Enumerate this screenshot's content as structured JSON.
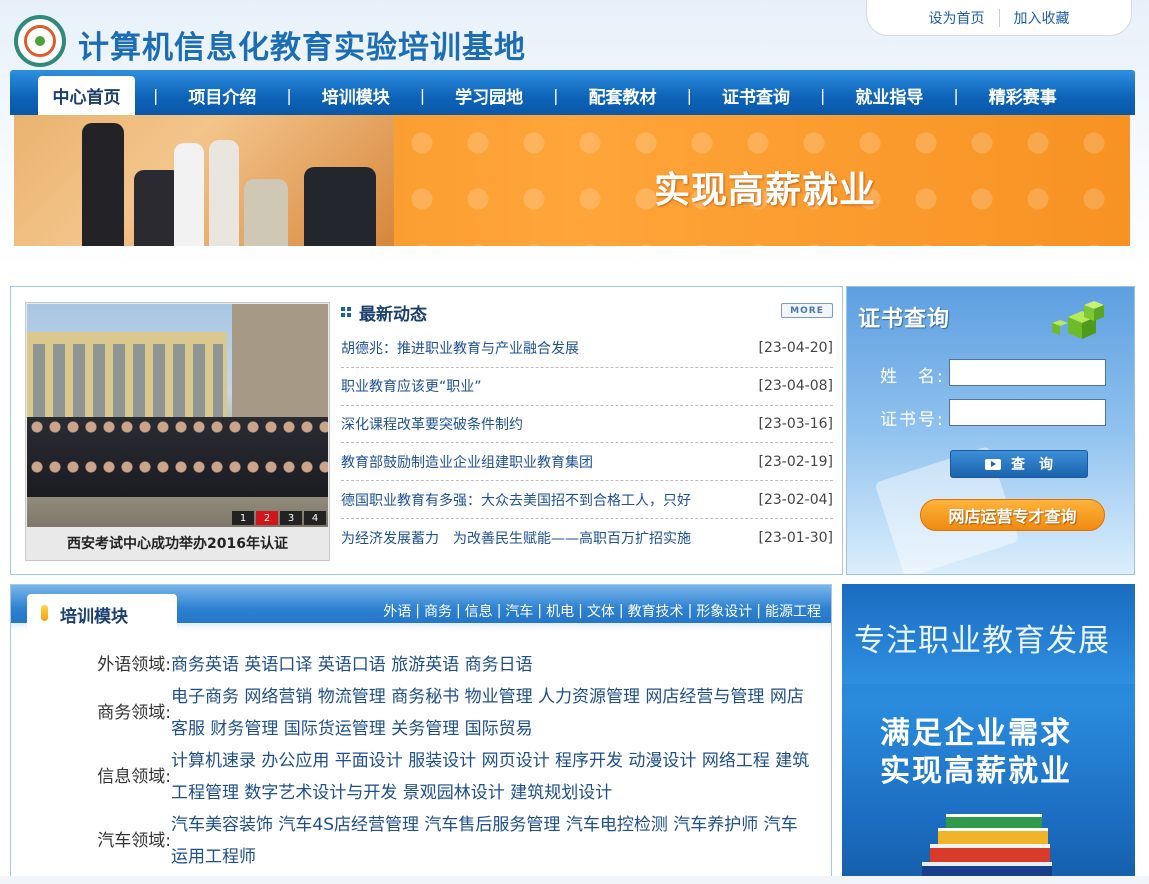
{
  "header": {
    "site_title": "计算机信息化教育实验培训基地",
    "toplinks": [
      "设为首页",
      "加入收藏"
    ]
  },
  "nav": {
    "items": [
      "中心首页",
      "项目介绍",
      "培训模块",
      "学习园地",
      "配套教材",
      "证书查询",
      "就业指导",
      "精彩赛事"
    ],
    "active": "中心首页",
    "separator": "|"
  },
  "banner": {
    "slogan": "实现高薪就业"
  },
  "news": {
    "title": "最新动态",
    "more_label": "MORE",
    "photo_caption": "西安考试中心成功举办2016年认证",
    "pager": [
      "1",
      "2",
      "3",
      "4"
    ],
    "pager_active": "2",
    "items": [
      {
        "title": "胡德兆：推进职业教育与产业融合发展",
        "date": "[23-04-20]"
      },
      {
        "title": "职业教育应该更“职业”",
        "date": "[23-04-08]"
      },
      {
        "title": "深化课程改革要突破条件制约",
        "date": "[23-03-16]"
      },
      {
        "title": "教育部鼓励制造业企业组建职业教育集团",
        "date": "[23-02-19]"
      },
      {
        "title": "德国职业教育有多强：大众去美国招不到合格工人，只好",
        "date": "[23-02-04]"
      },
      {
        "title": "为经济发展蓄力　为改善民生赋能——高职百万扩招实施",
        "date": "[23-01-30]"
      }
    ]
  },
  "cert": {
    "title": "证书查询",
    "name_label": "姓　名:",
    "cert_no_label": "证书号:",
    "name_value": "",
    "cert_no_value": "",
    "query_button": "查　询",
    "shop_button": "网店运营专才查询"
  },
  "training": {
    "title": "培训模块",
    "links": [
      "外语",
      "商务",
      "信息",
      "汽车",
      "机电",
      "文体",
      "教育技术",
      "形象设计",
      "能源工程"
    ],
    "rows": [
      {
        "category": "外语领域:",
        "items": "商务英语 英语口译 英语口语 旅游英语 商务日语"
      },
      {
        "category": "商务领域:",
        "items": "电子商务 网络营销 物流管理 商务秘书 物业管理 人力资源管理 网店经营与管理 网店客服 财务管理 国际货运管理 关务管理 国际贸易"
      },
      {
        "category": "信息领域:",
        "items": "计算机速录 办公应用 平面设计 服装设计 网页设计 程序开发 动漫设计 网络工程 建筑工程管理 数字艺术设计与开发 景观园林设计 建筑规划设计"
      },
      {
        "category": "汽车领域:",
        "items": "汽车美容装饰 汽车4S店经营管理 汽车售后服务管理 汽车电控检测 汽车养护师 汽车运用工程师"
      }
    ]
  },
  "ad": {
    "title": "专注职业教育发展",
    "slogan_line1": "满足企业需求",
    "slogan_line2": "实现高薪就业"
  }
}
